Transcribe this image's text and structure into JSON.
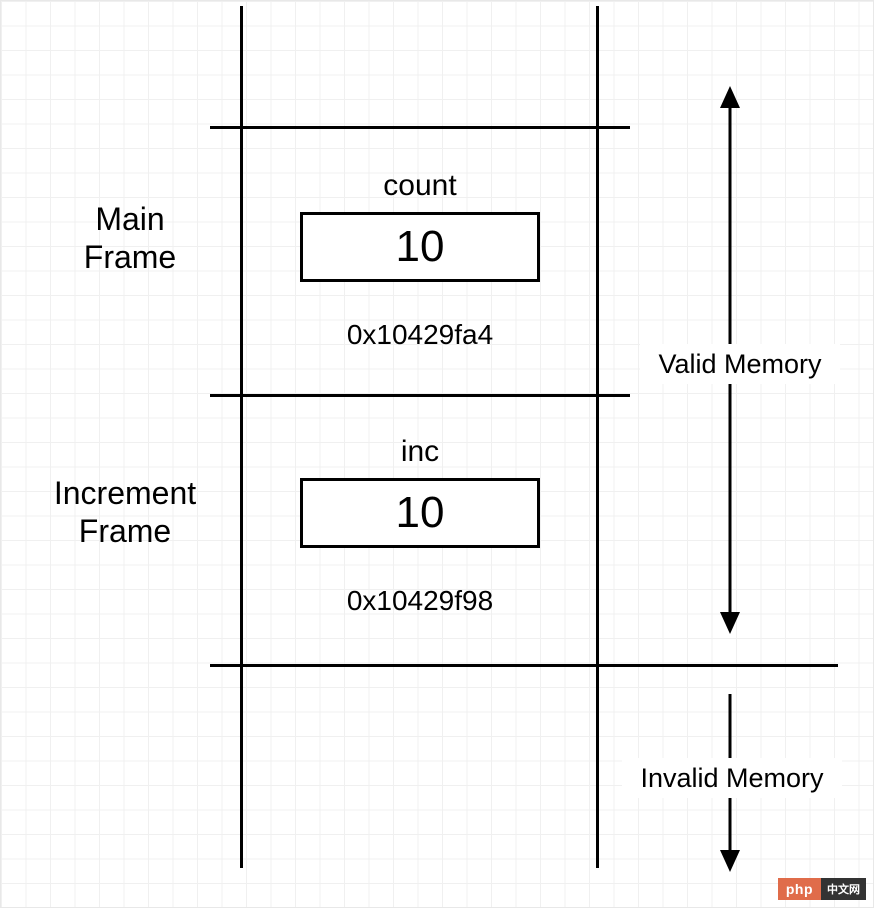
{
  "frames": {
    "main": {
      "label_line1": "Main",
      "label_line2": "Frame",
      "var_name": "count",
      "var_value": "10",
      "var_addr": "0x10429fa4"
    },
    "increment": {
      "label_line1": "Increment",
      "label_line2": "Frame",
      "var_name": "inc",
      "var_value": "10",
      "var_addr": "0x10429f98"
    }
  },
  "memory": {
    "valid_label": "Valid Memory",
    "invalid_label": "Invalid Memory"
  },
  "watermark": {
    "php": "php",
    "cn": "中文网"
  }
}
